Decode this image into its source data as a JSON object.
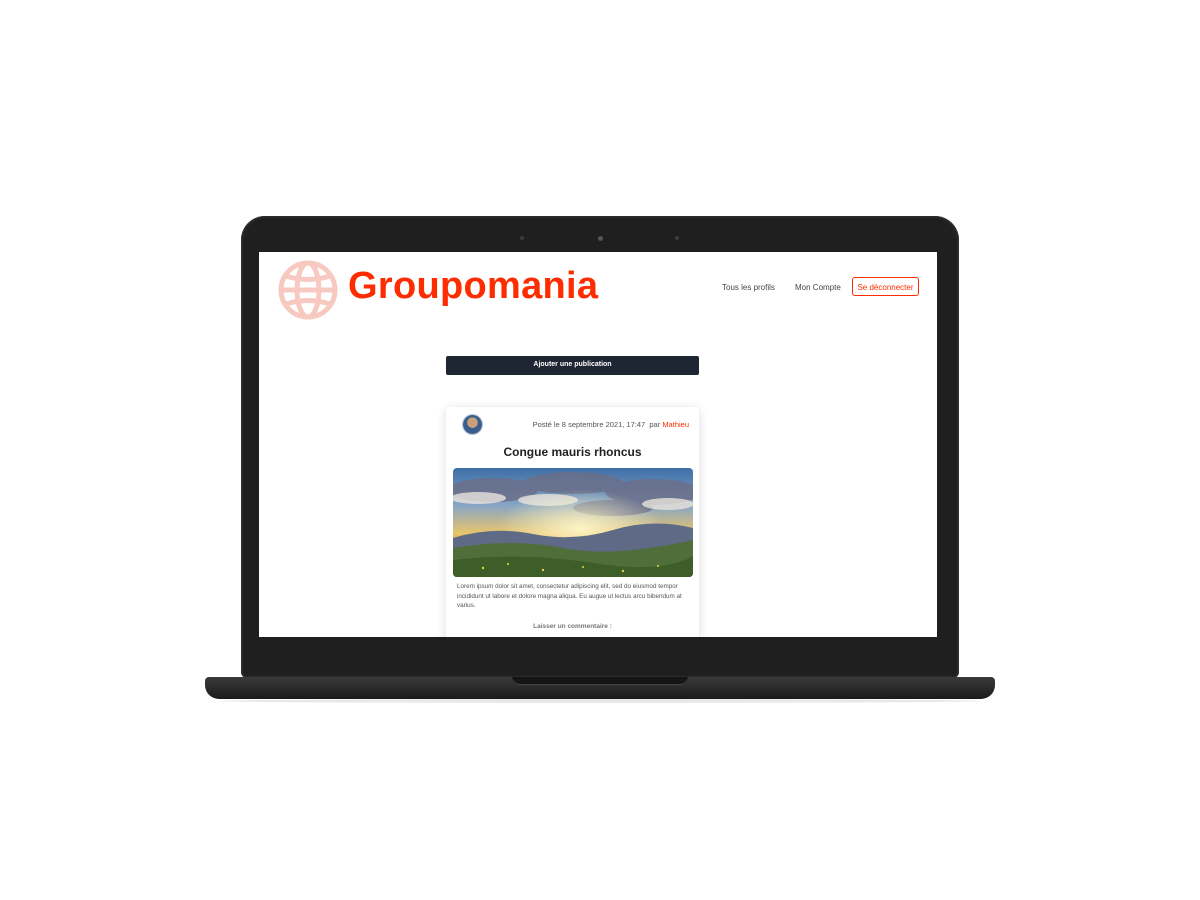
{
  "brand": {
    "name": "Groupomania",
    "logo_icon": "globe-icon",
    "accent": "#fd2d01"
  },
  "nav": {
    "all_profiles": "Tous les profils",
    "my_account": "Mon Compte",
    "logout": "Se déconnecter"
  },
  "actions": {
    "add_post": "Ajouter une publication"
  },
  "post": {
    "date_prefix": "Posté le 8 septembre 2021, 17:47",
    "by": "par",
    "author": "Mathieu",
    "title": "Congue mauris rhoncus",
    "image_description": "sunset-over-mountains",
    "body": "Lorem ipsum dolor sit amet, consectetur adipiscing elit, sed do eiusmod tempor incididunt ut labore et dolore magna aliqua. Eu augue ut lectus arcu bibendum at varius.",
    "comment_label": "Laisser un commentaire :"
  },
  "colors": {
    "header_button_bg": "#1f2633",
    "laptop_body": "#1f1f1f"
  }
}
